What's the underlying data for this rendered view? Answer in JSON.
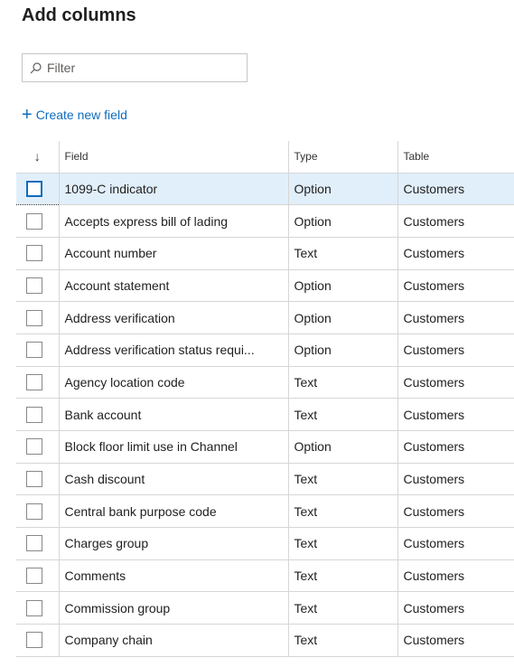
{
  "panel": {
    "title": "Add columns"
  },
  "filter": {
    "placeholder": "Filter",
    "value": ""
  },
  "create_new_field": {
    "label": "Create new field"
  },
  "grid": {
    "columns": {
      "sort": "↓",
      "field": "Field",
      "type": "Type",
      "table": "Table"
    },
    "rows": [
      {
        "field": "1099-C indicator",
        "type": "Option",
        "table": "Customers",
        "selected": true
      },
      {
        "field": "Accepts express bill of lading",
        "type": "Option",
        "table": "Customers"
      },
      {
        "field": "Account number",
        "type": "Text",
        "table": "Customers"
      },
      {
        "field": "Account statement",
        "type": "Option",
        "table": "Customers"
      },
      {
        "field": "Address verification",
        "type": "Option",
        "table": "Customers"
      },
      {
        "field": "Address verification status requi...",
        "type": "Option",
        "table": "Customers"
      },
      {
        "field": "Agency location code",
        "type": "Text",
        "table": "Customers"
      },
      {
        "field": "Bank account",
        "type": "Text",
        "table": "Customers"
      },
      {
        "field": "Block floor limit use in Channel",
        "type": "Option",
        "table": "Customers"
      },
      {
        "field": "Cash discount",
        "type": "Text",
        "table": "Customers"
      },
      {
        "field": "Central bank purpose code",
        "type": "Text",
        "table": "Customers"
      },
      {
        "field": "Charges group",
        "type": "Text",
        "table": "Customers"
      },
      {
        "field": "Comments",
        "type": "Text",
        "table": "Customers"
      },
      {
        "field": "Commission group",
        "type": "Text",
        "table": "Customers"
      },
      {
        "field": "Company chain",
        "type": "Text",
        "table": "Customers"
      }
    ]
  },
  "colors": {
    "accent": "#0f6cbd",
    "selected_row": "#e1effa",
    "border": "#d6d6d6"
  }
}
